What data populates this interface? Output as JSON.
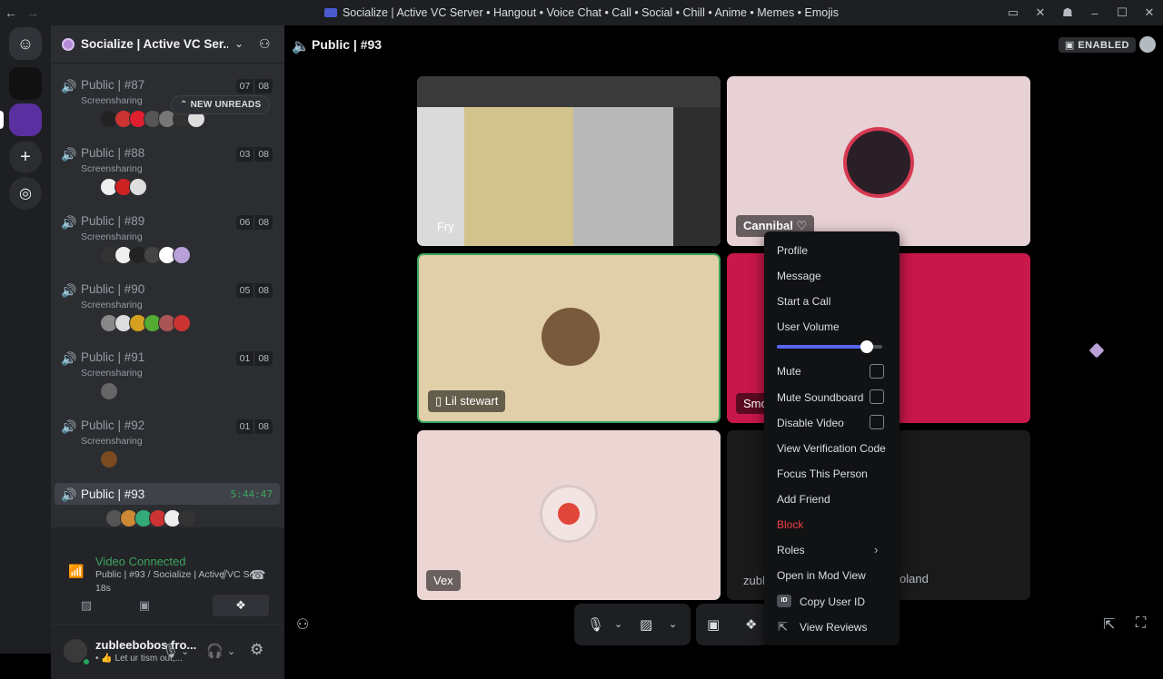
{
  "titlebar": {
    "title": "Socialize | Active VC Server • Hangout • Voice Chat • Call • Social • Chill • Anime • Memes • Emojis"
  },
  "server": {
    "name": "Socialize | Active VC Ser..."
  },
  "new_unreads": "NEW UNREADS",
  "channels": [
    {
      "name": "Public | #87",
      "sub": "Screensharing",
      "count": "07",
      "limit": "08"
    },
    {
      "name": "Public | #88",
      "sub": "Screensharing",
      "count": "03",
      "limit": "08"
    },
    {
      "name": "Public | #89",
      "sub": "Screensharing",
      "count": "06",
      "limit": "08"
    },
    {
      "name": "Public | #90",
      "sub": "Screensharing",
      "count": "05",
      "limit": "08"
    },
    {
      "name": "Public | #91",
      "sub": "Screensharing",
      "count": "01",
      "limit": "08"
    },
    {
      "name": "Public | #92",
      "sub": "Screensharing",
      "count": "01",
      "limit": "08"
    }
  ],
  "active_channel": {
    "name": "Public | #93",
    "timer": "5:44:47"
  },
  "voice": {
    "status": "Video Connected",
    "channel": "Public | #93 / Socialize | Active VC Se...",
    "elapsed": "18s"
  },
  "user": {
    "name": "zubleebobos fro...",
    "status": "Let ur tism out,..."
  },
  "header": {
    "channel": "Public | #93",
    "badge": "ENABLED"
  },
  "tiles": {
    "fry": "Fry",
    "cannibal": "Cannibal ♡",
    "lil_stewart": "Lil stewart",
    "smo": "Smo",
    "vex": "Vex",
    "zubl": "zubl",
    "roland": "oland"
  },
  "context_menu": {
    "profile": "Profile",
    "message": "Message",
    "start_call": "Start a Call",
    "user_volume": "User Volume",
    "volume_level": 0.85,
    "mute": "Mute",
    "mute_soundboard": "Mute Soundboard",
    "disable_video": "Disable Video",
    "view_verification": "View Verification Code",
    "focus": "Focus This Person",
    "add_friend": "Add Friend",
    "block": "Block",
    "roles": "Roles",
    "mod_view": "Open in Mod View",
    "copy_id": "Copy User ID",
    "view_reviews": "View Reviews"
  },
  "colors": {
    "accent": "#5865f2",
    "connected": "#3ba55c",
    "danger": "#f23f42"
  }
}
